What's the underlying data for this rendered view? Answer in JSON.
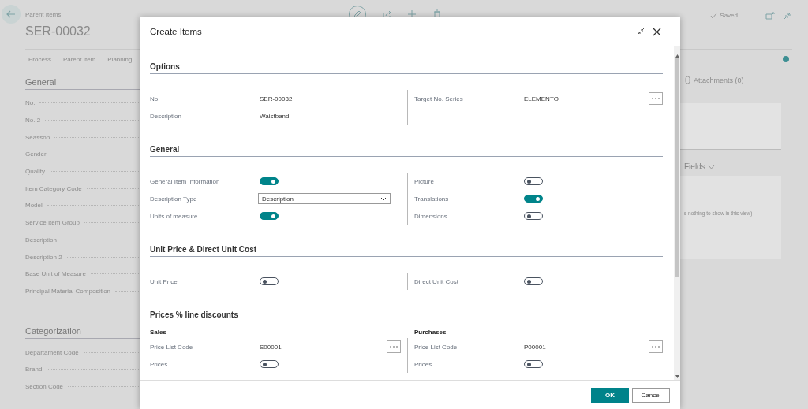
{
  "page": {
    "breadcrumb": "Parent Items",
    "title": "SER-00032",
    "status": "Saved",
    "actions": [
      "Process",
      "Parent Item",
      "Planning"
    ],
    "sections": [
      {
        "title": "General",
        "fields": [
          "No.",
          "No. 2",
          "Seasson",
          "Gender",
          "Quality",
          "Item Category Code",
          "Model",
          "Service Item Group",
          "Description",
          "Description 2",
          "Base Unit of Measure",
          "Principal Material Composition"
        ]
      },
      {
        "title": "Categorization",
        "fields": [
          "Departament Code",
          "Brand",
          "Section Code"
        ]
      }
    ],
    "attachments": "Attachments (0)",
    "fields_heading": "Fields",
    "empty_text": "s nothing to show in this view)"
  },
  "dialog": {
    "title": "Create Items",
    "sections": [
      {
        "title": "Options",
        "columns": [
          {
            "rows": [
              {
                "kind": "text",
                "label": "No.",
                "value": "SER-00032",
                "lookup": false
              },
              {
                "kind": "text",
                "label": "Description",
                "value": "Waistband",
                "lookup": false
              }
            ]
          },
          {
            "rows": [
              {
                "kind": "text",
                "label": "Target No. Series",
                "value": "ELEMENTO",
                "lookup": true
              }
            ]
          }
        ]
      },
      {
        "title": "General",
        "columns": [
          {
            "rows": [
              {
                "kind": "toggle",
                "label": "General Item Information",
                "on": true
              },
              {
                "kind": "select",
                "label": "Description Type",
                "value": "Description"
              },
              {
                "kind": "toggle",
                "label": "Units of measure",
                "on": true
              }
            ]
          },
          {
            "rows": [
              {
                "kind": "toggle",
                "label": "Picture",
                "on": false
              },
              {
                "kind": "toggle",
                "label": "Translations",
                "on": true
              },
              {
                "kind": "toggle",
                "label": "Dimensions",
                "on": false
              }
            ]
          }
        ]
      },
      {
        "title": "Unit Price & Direct Unit Cost",
        "columns": [
          {
            "rows": [
              {
                "kind": "toggle",
                "label": "Unit Price",
                "on": false
              }
            ]
          },
          {
            "rows": [
              {
                "kind": "toggle",
                "label": "Direct Unit Cost",
                "on": false
              }
            ]
          }
        ]
      },
      {
        "title": "Prices % line discounts",
        "columns": [
          {
            "heading": "Sales",
            "rows": [
              {
                "kind": "text",
                "label": "Price List Code",
                "value": "S00001",
                "lookup": true
              },
              {
                "kind": "toggle",
                "label": "Prices",
                "on": false
              }
            ]
          },
          {
            "heading": "Purchases",
            "rows": [
              {
                "kind": "text",
                "label": "Price List Code",
                "value": "P00001",
                "lookup": true
              },
              {
                "kind": "toggle",
                "label": "Prices",
                "on": false
              }
            ]
          }
        ]
      }
    ],
    "buttons": [
      {
        "label": "OK",
        "kind": "primary"
      },
      {
        "label": "Cancel",
        "kind": "secondary"
      }
    ]
  }
}
